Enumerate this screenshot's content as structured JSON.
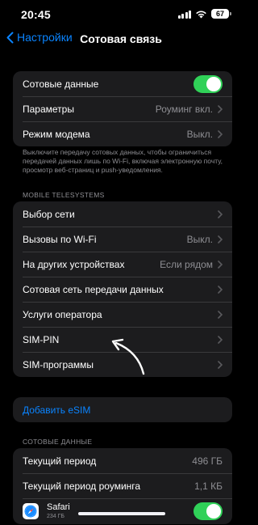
{
  "status_bar": {
    "time": "20:45",
    "battery": "67"
  },
  "nav": {
    "back_label": "Настройки",
    "title": "Сотовая связь"
  },
  "group1": {
    "cellular_data_label": "Сотовые данные",
    "cellular_data_on": true,
    "params_label": "Параметры",
    "params_value": "Роуминг вкл.",
    "modem_label": "Режим модема",
    "modem_value": "Выкл."
  },
  "note": "Выключите передачу сотовых данных, чтобы ограничиться передачей данных лишь по Wi-Fi, включая электронную почту, просмотр веб-страниц и push-уведомления.",
  "operator_header": "MOBILE TELESYSTEMS",
  "group2": [
    {
      "label": "Выбор сети",
      "value": ""
    },
    {
      "label": "Вызовы по Wi-Fi",
      "value": "Выкл."
    },
    {
      "label": "На других устройствах",
      "value": "Если рядом"
    },
    {
      "label": "Сотовая сеть передачи данных",
      "value": ""
    },
    {
      "label": "Услуги оператора",
      "value": ""
    },
    {
      "label": "SIM-PIN",
      "value": ""
    },
    {
      "label": "SIM-программы",
      "value": ""
    }
  ],
  "esim": {
    "label": "Добавить eSIM"
  },
  "data_header": "СОТОВЫЕ ДАННЫЕ",
  "usage": {
    "current_label": "Текущий период",
    "current_value": "496 ГБ",
    "roaming_label": "Текущий период роуминга",
    "roaming_value": "1,1 КБ",
    "app_name": "Safari",
    "app_usage": "234 ГБ",
    "app_enabled": true
  },
  "colors": {
    "accent": "#0a84ff",
    "toggle_on": "#30d158",
    "cell_bg": "#1c1c1e"
  },
  "icons": [
    "back-chevron-icon",
    "chevron-right-icon",
    "signal-icon",
    "wifi-icon",
    "battery-icon",
    "safari-icon",
    "arrow-annotation"
  ]
}
